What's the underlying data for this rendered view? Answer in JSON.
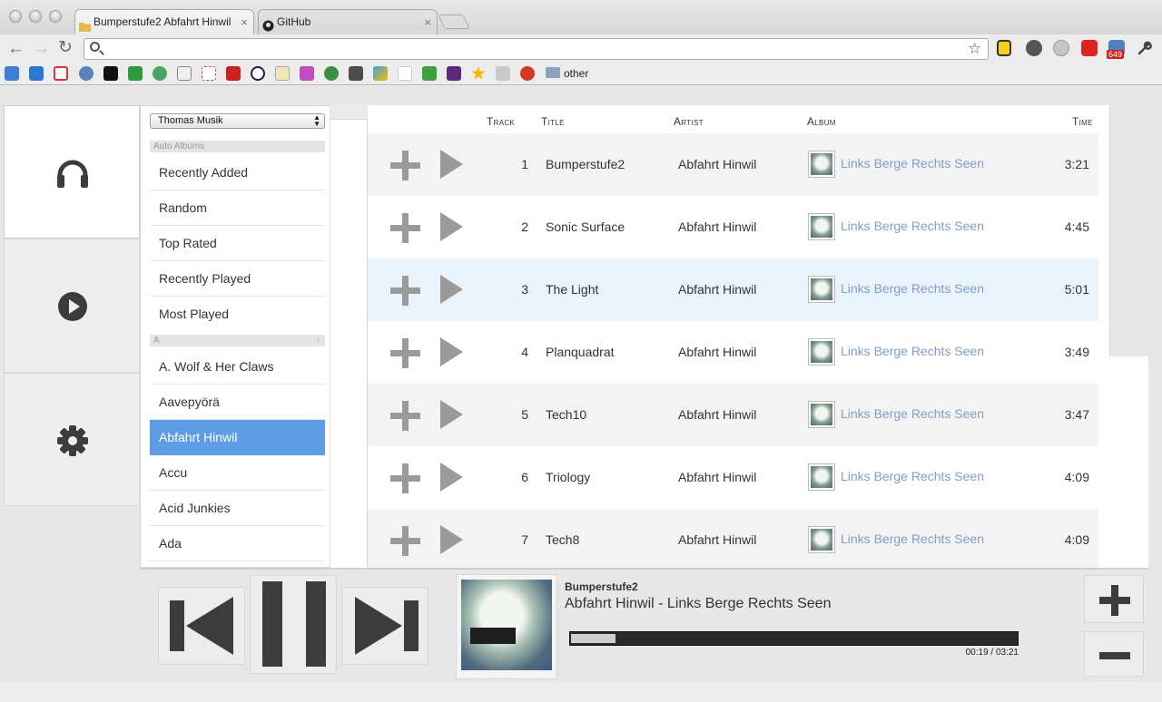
{
  "browser": {
    "tabs": [
      {
        "label": "Bumperstufe2 Abfahrt Hinwil",
        "close": "×",
        "active": true
      },
      {
        "label": "GitHub",
        "close": "×",
        "active": false
      }
    ],
    "nav": {
      "back": "←",
      "forward": "→",
      "reload": "↻"
    },
    "address": {
      "value": ""
    },
    "star": "☆",
    "extension_badge": "649",
    "bookmarks_folder": "other"
  },
  "library": {
    "selected": "Thomas Musik",
    "auto_albums_header": "Auto Albums",
    "auto_albums": [
      "Recently Added",
      "Random",
      "Top Rated",
      "Recently Played",
      "Most Played"
    ],
    "letter_header": "A",
    "letter_arrow": "↑",
    "artists": [
      "A. Wolf & Her Claws",
      "Aavepyörä",
      "Abfahrt Hinwil",
      "Accu",
      "Acid Junkies",
      "Ada"
    ],
    "selected_artist": "Abfahrt Hinwil"
  },
  "tracklist": {
    "headers": {
      "track": "Track",
      "title": "Title",
      "artist": "Artist",
      "album": "Album",
      "time": "Time"
    },
    "rows": [
      {
        "track": "1",
        "title": "Bumperstufe2",
        "artist": "Abfahrt Hinwil",
        "album": "Links Berge Rechts Seen",
        "time": "3:21"
      },
      {
        "track": "2",
        "title": "Sonic Surface",
        "artist": "Abfahrt Hinwil",
        "album": "Links Berge Rechts Seen",
        "time": "4:45"
      },
      {
        "track": "3",
        "title": "The Light",
        "artist": "Abfahrt Hinwil",
        "album": "Links Berge Rechts Seen",
        "time": "5:01"
      },
      {
        "track": "4",
        "title": "Planquadrat",
        "artist": "Abfahrt Hinwil",
        "album": "Links Berge Rechts Seen",
        "time": "3:49"
      },
      {
        "track": "5",
        "title": "Tech10",
        "artist": "Abfahrt Hinwil",
        "album": "Links Berge Rechts Seen",
        "time": "3:47"
      },
      {
        "track": "6",
        "title": "Triology",
        "artist": "Abfahrt Hinwil",
        "album": "Links Berge Rechts Seen",
        "time": "4:09"
      },
      {
        "track": "7",
        "title": "Tech8",
        "artist": "Abfahrt Hinwil",
        "album": "Links Berge Rechts Seen",
        "time": "4:09"
      }
    ]
  },
  "player": {
    "track": "Bumperstufe2",
    "subtitle": "Abfahrt Hinwil - Links Berge Rechts Seen",
    "position": "00:19",
    "duration": "03:21",
    "progress_fraction": 0.1,
    "time_readout": "00:19 / 03:21"
  },
  "colors": {
    "selection": "#5e9de6",
    "album_link": "#7f9ec8",
    "icon_dark": "#3c3c3c",
    "icon_gray": "#9a9a9a"
  },
  "icons": [
    "headphones-icon",
    "play-circle-icon",
    "gear-icon",
    "plus-icon",
    "play-icon",
    "previous-icon",
    "pause-icon",
    "next-icon",
    "volume-up-icon",
    "volume-down-icon"
  ]
}
